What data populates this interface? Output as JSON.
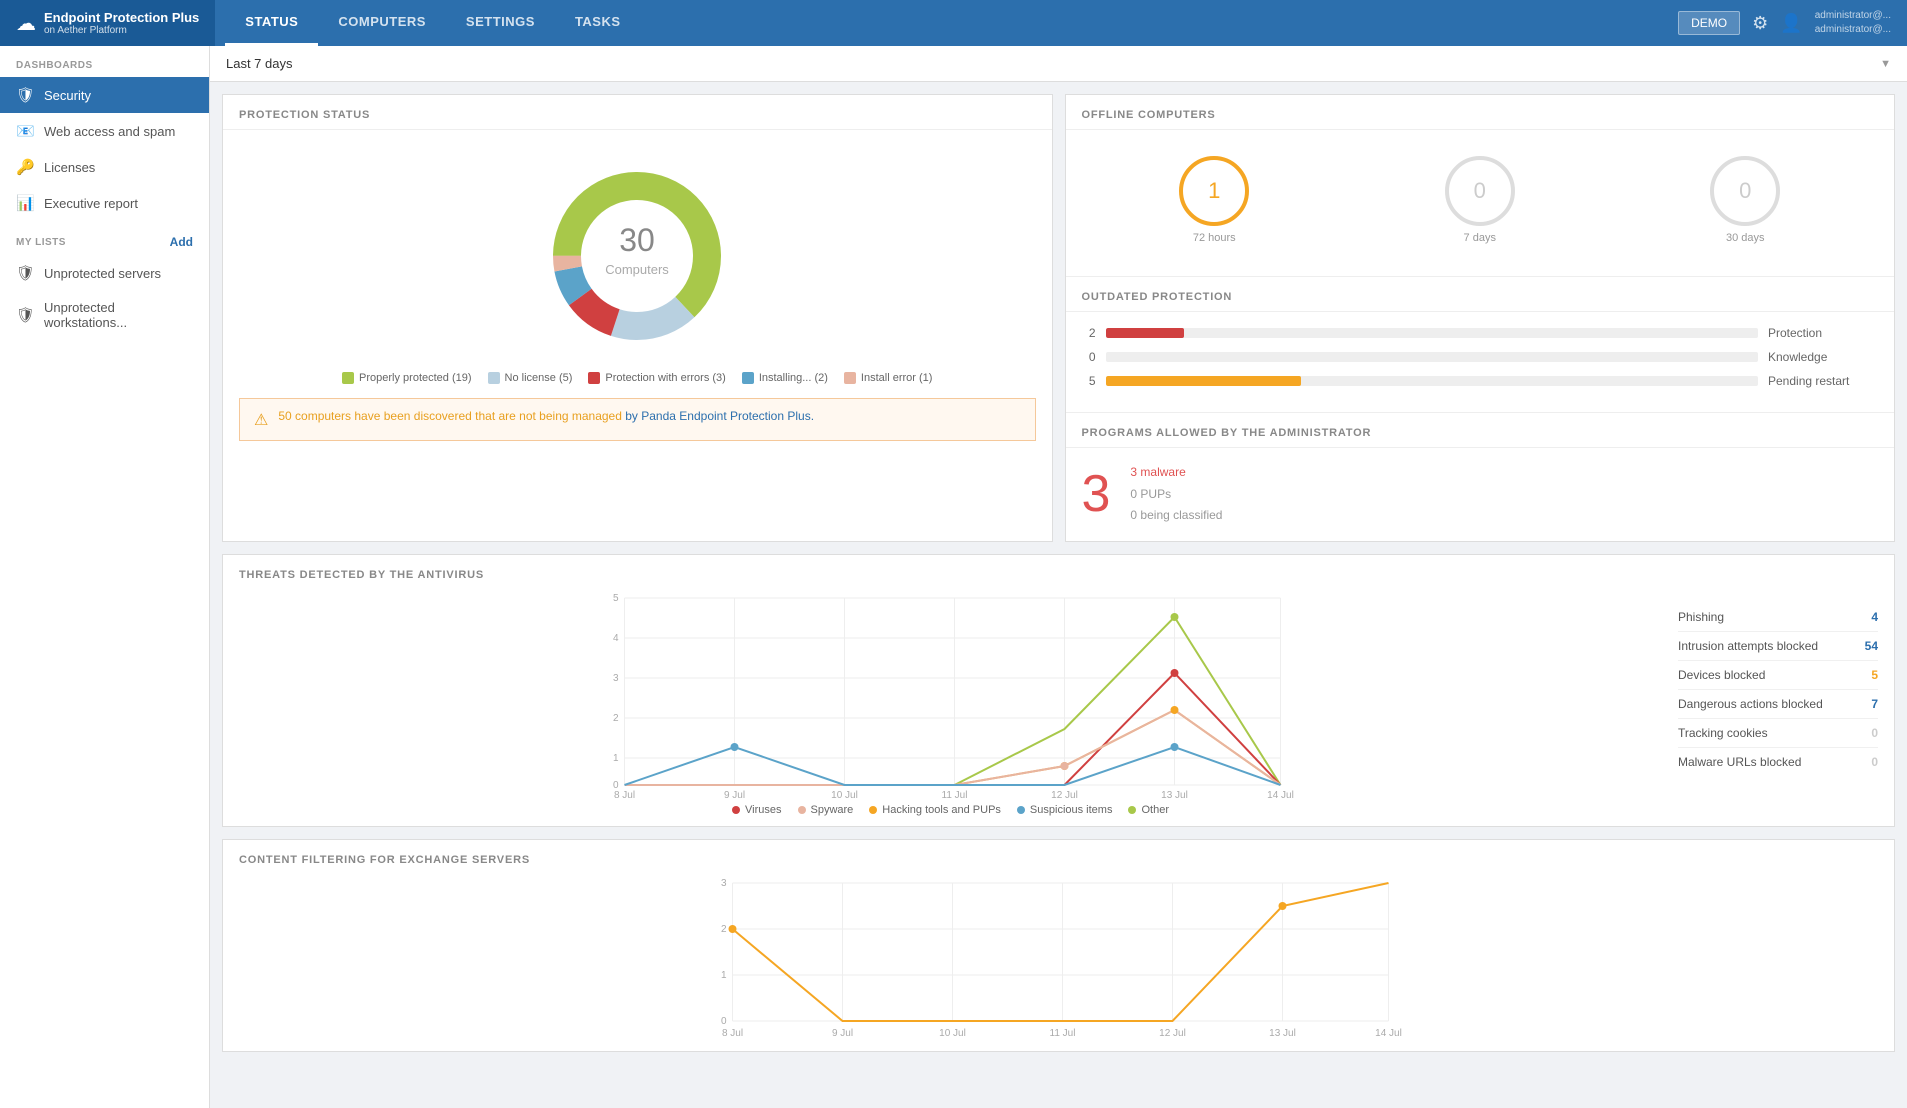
{
  "brand": {
    "name": "Endpoint Protection Plus",
    "sub": "on Aether Platform",
    "icon": "☁"
  },
  "nav": {
    "tabs": [
      {
        "label": "STATUS",
        "active": true
      },
      {
        "label": "COMPUTERS",
        "active": false
      },
      {
        "label": "SETTINGS",
        "active": false
      },
      {
        "label": "TASKS",
        "active": false
      }
    ],
    "demo_label": "DEMO",
    "user_info_line1": "administrator@...",
    "user_info_line2": "administrator@..."
  },
  "sidebar": {
    "dashboards_label": "DASHBOARDS",
    "items": [
      {
        "id": "security",
        "label": "Security",
        "icon": "🛡",
        "active": true
      },
      {
        "id": "web-access",
        "label": "Web access and spam",
        "icon": "📧",
        "active": false
      },
      {
        "id": "licenses",
        "label": "Licenses",
        "icon": "🔑",
        "active": false
      },
      {
        "id": "executive",
        "label": "Executive report",
        "icon": "📊",
        "active": false
      }
    ],
    "my_lists_label": "MY LISTS",
    "add_label": "Add",
    "list_items": [
      {
        "label": "Unprotected servers",
        "icon": "🛡"
      },
      {
        "label": "Unprotected workstations...",
        "icon": "🛡"
      }
    ]
  },
  "date_filter": {
    "value": "Last 7 days"
  },
  "protection_status": {
    "title": "PROTECTION STATUS",
    "total": "30",
    "total_label": "Computers",
    "segments": [
      {
        "label": "Properly protected (19)",
        "value": 19,
        "color": "#a8c84a",
        "percent": 63
      },
      {
        "label": "No license (5)",
        "value": 5,
        "color": "#b8d0e0",
        "percent": 17
      },
      {
        "label": "Protection with errors (3)",
        "value": 3,
        "color": "#d04040",
        "percent": 10
      },
      {
        "label": "Installing... (2)",
        "value": 2,
        "color": "#5ba3c9",
        "percent": 7
      },
      {
        "label": "Install error (1)",
        "value": 1,
        "color": "#e8b4a0",
        "percent": 3
      }
    ],
    "warning": {
      "text": "50 computers have been discovered that are not being managed",
      "link_text": "by Panda Endpoint Protection Plus."
    }
  },
  "offline_computers": {
    "title": "OFFLINE COMPUTERS",
    "gauges": [
      {
        "value": "1",
        "label": "72 hours",
        "active": true
      },
      {
        "value": "0",
        "label": "7 days",
        "active": false
      },
      {
        "value": "0",
        "label": "30 days",
        "active": false
      }
    ]
  },
  "outdated_protection": {
    "title": "OUTDATED PROTECTION",
    "rows": [
      {
        "num": "2",
        "label": "Protection",
        "fill_pct": 12,
        "color": "#d04040"
      },
      {
        "num": "0",
        "label": "Knowledge",
        "fill_pct": 0,
        "color": "#ccc"
      },
      {
        "num": "5",
        "label": "Pending restart",
        "fill_pct": 30,
        "color": "#f5a623"
      }
    ]
  },
  "programs_allowed": {
    "title": "PROGRAMS ALLOWED BY THE ADMINISTRATOR",
    "count": "3",
    "malware": "3 malware",
    "pups": "0 PUPs",
    "classified": "0 being classified"
  },
  "threats_chart": {
    "title": "THREATS DETECTED BY THE ANTIVIRUS",
    "y_max": 5,
    "y_labels": [
      "5",
      "4",
      "3",
      "2",
      "1",
      "0"
    ],
    "x_labels": [
      "8 Jul",
      "9 Jul",
      "10 Jul",
      "11 Jul",
      "12 Jul",
      "13 Jul",
      "14 Jul"
    ],
    "series": [
      {
        "name": "Viruses",
        "color": "#d04040",
        "points": [
          0,
          0,
          0,
          0,
          0,
          3,
          0
        ]
      },
      {
        "name": "Spyware",
        "color": "#e8b4a0",
        "points": [
          0,
          0,
          0,
          0,
          0.5,
          2,
          0
        ]
      },
      {
        "name": "Hacking tools and PUPs",
        "color": "#f5a623",
        "points": [
          0,
          0,
          0,
          0,
          0.5,
          2,
          0
        ]
      },
      {
        "name": "Suspicious items",
        "color": "#5ba3c9",
        "points": [
          0,
          1,
          0,
          0,
          0,
          1,
          0
        ]
      },
      {
        "name": "Other",
        "color": "#a8c84a",
        "points": [
          0,
          0,
          0,
          0,
          1.5,
          4.5,
          0
        ]
      }
    ],
    "stats": [
      {
        "label": "Phishing",
        "value": "4",
        "color": "blue"
      },
      {
        "label": "Intrusion attempts blocked",
        "value": "54",
        "color": "blue"
      },
      {
        "label": "Devices blocked",
        "value": "5",
        "color": "orange"
      },
      {
        "label": "Dangerous actions blocked",
        "value": "7",
        "color": "blue"
      },
      {
        "label": "Tracking cookies",
        "value": "0",
        "color": "gray"
      },
      {
        "label": "Malware URLs blocked",
        "value": "0",
        "color": "gray"
      }
    ]
  },
  "exchange_chart": {
    "title": "CONTENT FILTERING FOR EXCHANGE SERVERS",
    "y_max": 3,
    "y_labels": [
      "3",
      "2",
      "1",
      "0"
    ],
    "x_labels": [
      "8 Jul",
      "9 Jul",
      "10 Jul",
      "11 Jul",
      "12 Jul",
      "13 Jul",
      "14 Jul"
    ]
  }
}
